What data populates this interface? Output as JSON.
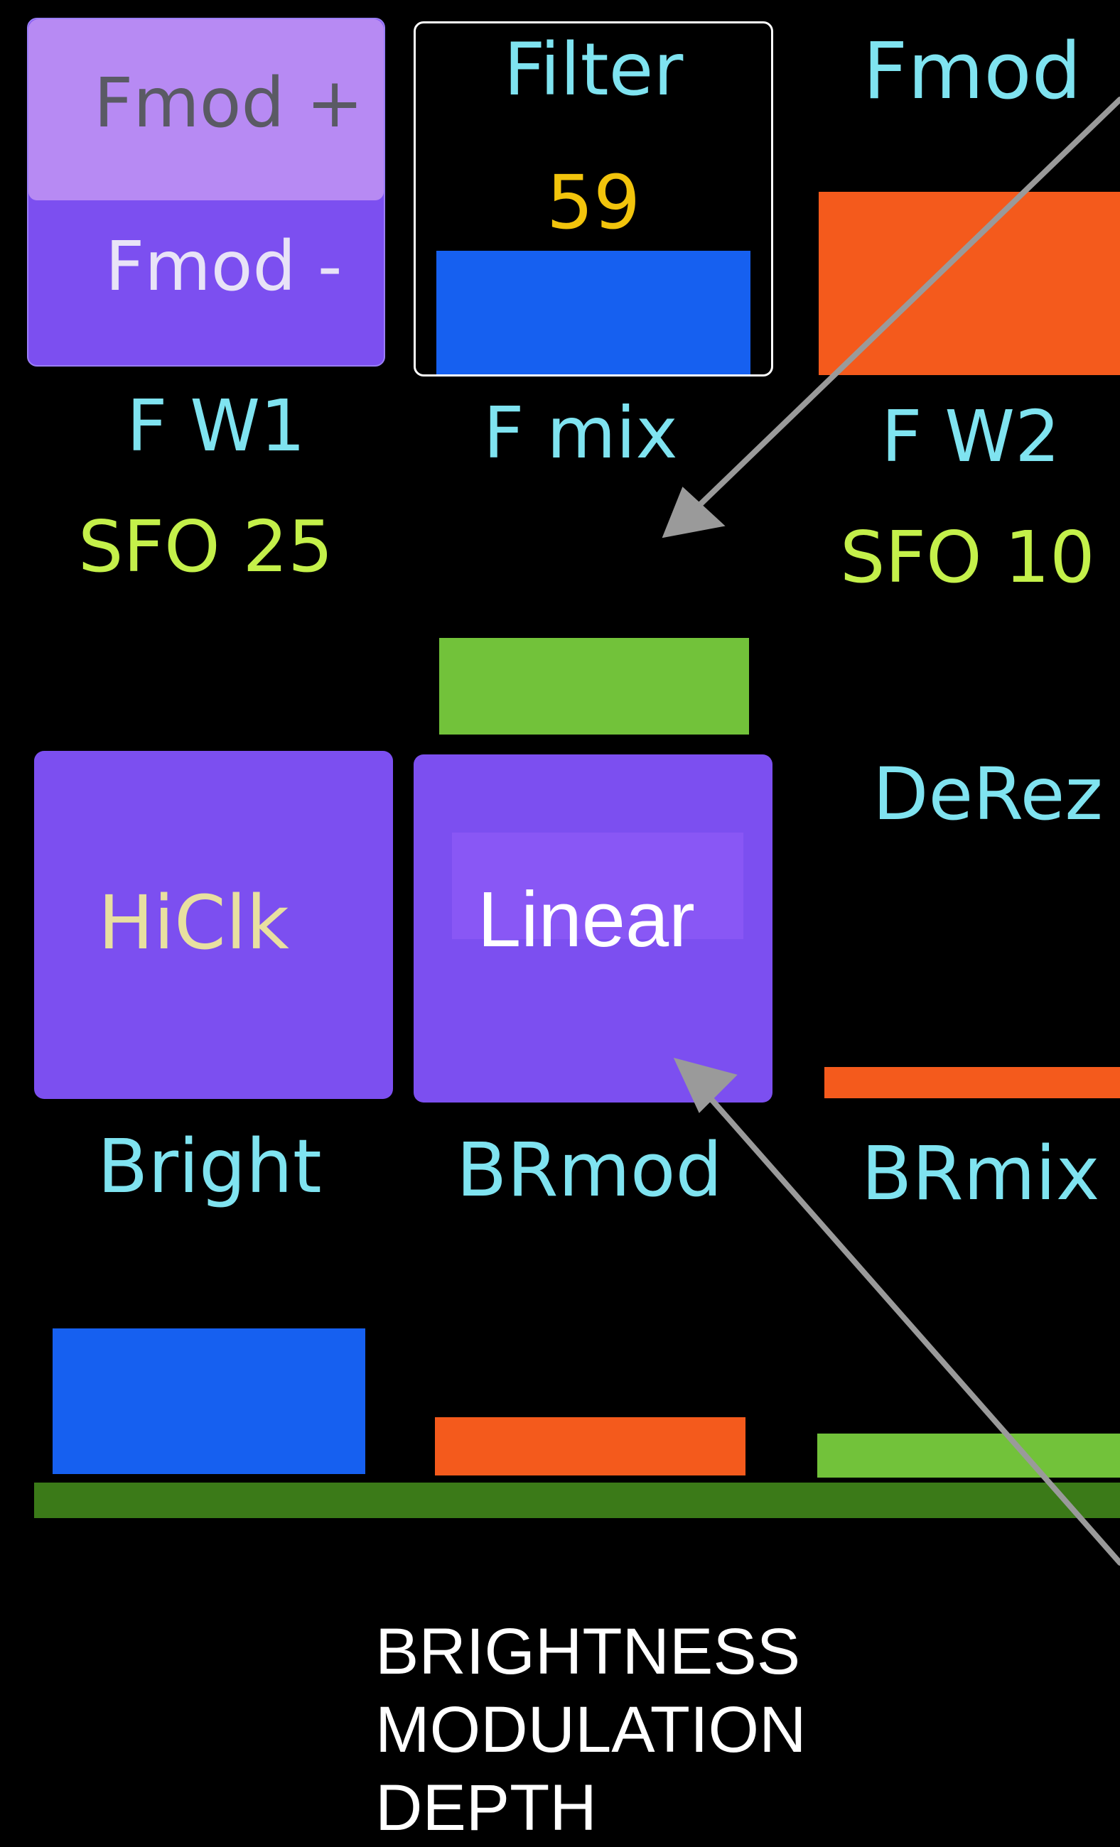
{
  "colors": {
    "background": "#000000",
    "purple": "#7c4ff0",
    "lavender": "#b78af3",
    "blue": "#1660f0",
    "orange": "#f45a1c",
    "green": "#72c23a",
    "dark_green": "#3b7a18",
    "cyan_text": "#7fe3f0",
    "lime_text": "#c4f04a",
    "gold_text": "#f2c40c",
    "arrow": "#9a9a9a"
  },
  "fmod_toggle": {
    "top_label": "Fmod +",
    "bottom_label": "Fmod -"
  },
  "filter_control": {
    "label": "Filter",
    "value": "59",
    "level": 0.34
  },
  "fmod_control": {
    "label": "Fmod"
  },
  "labels": {
    "fw1": "F W1",
    "fmix": "F mix",
    "fw2": "F W2",
    "sfo_left": "SFO 25",
    "sfo_right": "SFO 10",
    "derez": "DeRez",
    "bright": "Bright",
    "brmod": "BRmod",
    "brmix": "BRmix"
  },
  "buttons": {
    "hiclk": "HiClk",
    "linear": "Linear"
  },
  "annotation": {
    "line1": "BRIGHTNESS",
    "line2": "MODULATION",
    "line3": "DEPTH"
  },
  "icons": [
    "arrow-to-fmix-icon",
    "arrow-to-linear-icon"
  ]
}
